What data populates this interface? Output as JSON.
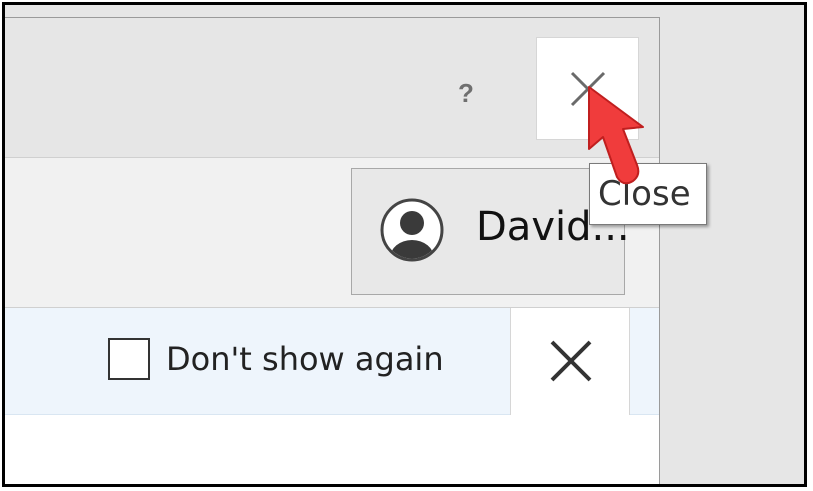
{
  "titlebar": {
    "help_label": "?",
    "close_icon": "close-icon"
  },
  "account": {
    "name": "David...",
    "avatar_icon": "person-avatar-icon"
  },
  "notice": {
    "checkbox_label": "Don't show again",
    "checkbox_checked": false,
    "close_icon": "close-icon"
  },
  "tooltip": {
    "text": "Close"
  },
  "colors": {
    "titlebar_bg": "#e6e6e6",
    "notice_bg": "#eef5fc",
    "cursor": "#f03c3c"
  }
}
